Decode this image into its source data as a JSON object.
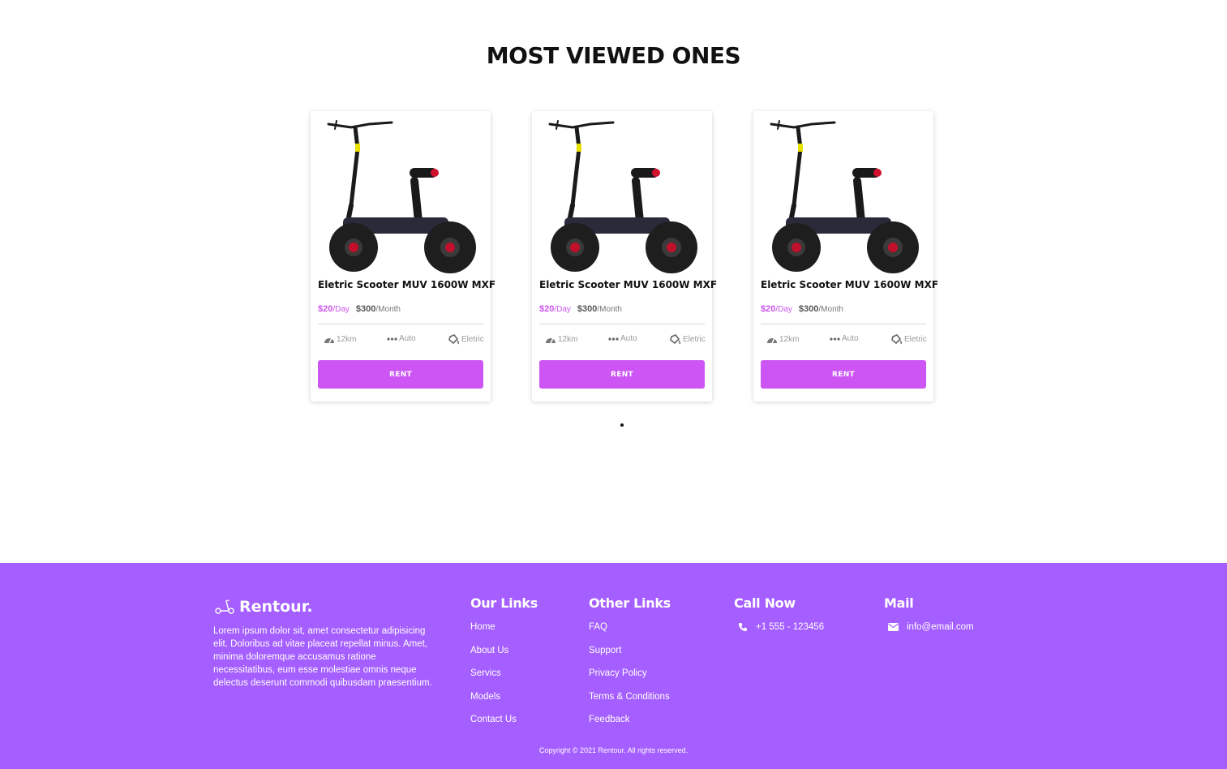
{
  "section": {
    "title": "MOST VIEWED ONES"
  },
  "cards": [
    {
      "title": "Eletric Scooter MUV 1600W MXF",
      "price_day": "$20",
      "unit_day": "/Day",
      "price_month": "$300",
      "unit_month": "/Month",
      "spec_range": "12km",
      "spec_mode": "Auto",
      "spec_type": "Eletric",
      "button": "RENT"
    },
    {
      "title": "Eletric Scooter MUV 1600W MXF",
      "price_day": "$20",
      "unit_day": "/Day",
      "price_month": "$300",
      "unit_month": "/Month",
      "spec_range": "12km",
      "spec_mode": "Auto",
      "spec_type": "Eletric",
      "button": "RENT"
    },
    {
      "title": "Eletric Scooter MUV 1600W MXF",
      "price_day": "$20",
      "unit_day": "/Day",
      "price_month": "$300",
      "unit_month": "/Month",
      "spec_range": "12km",
      "spec_mode": "Auto",
      "spec_type": "Eletric",
      "button": "RENT"
    }
  ],
  "icons": {
    "range": "speedometer-icon",
    "mode": "dots-icon",
    "type": "fuel-icon",
    "brand": "scooter-icon",
    "phone": "phone-icon",
    "mail": "envelope-icon"
  },
  "colors": {
    "accent": "#cc55f4",
    "footer_bg": "#a55eff"
  },
  "footer": {
    "brand": "Rentour.",
    "description": "Lorem ipsum dolor sit, amet consectetur adipisicing elit. Doloribus ad vitae placeat repellat minus. Amet, minima doloremque accusamus ratione necessitatibus, eum esse molestiae omnis neque delectus deserunt commodi quibusdam praesentium.",
    "our_links": {
      "title": "Our Links",
      "items": [
        "Home",
        "About Us",
        "Servics",
        "Models",
        "Contact Us"
      ]
    },
    "other_links": {
      "title": "Other Links",
      "items": [
        "FAQ",
        "Support",
        "Privacy Policy",
        "Terms & Conditions",
        "Feedback"
      ]
    },
    "call": {
      "title": "Call Now",
      "phone": "+1 555 - 123456"
    },
    "mail": {
      "title": "Mail",
      "email": "info@email.com"
    },
    "copyright": "Copyright © 2021 Rentour. All rights reserved."
  }
}
